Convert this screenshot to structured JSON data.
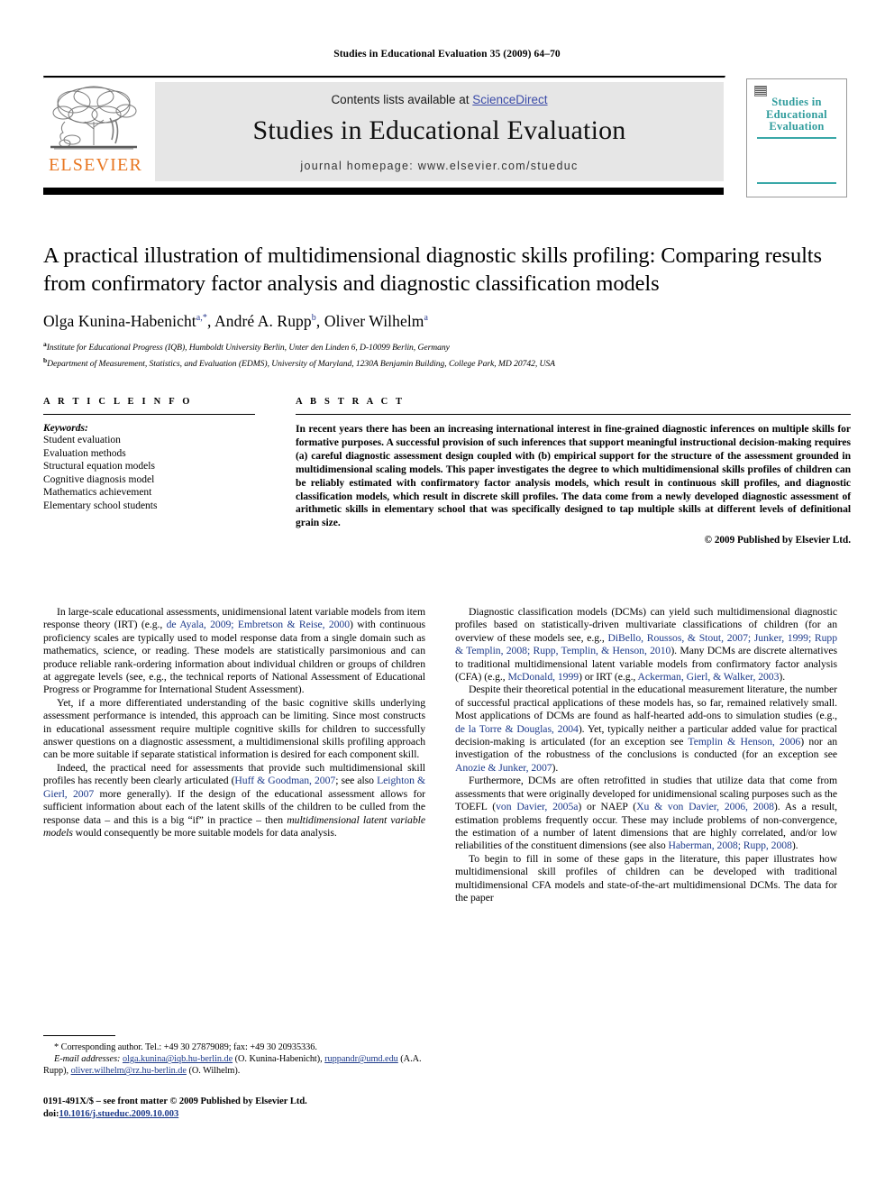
{
  "running_head": "Studies in Educational Evaluation 35 (2009) 64–70",
  "masthead": {
    "contents_prefix": "Contents lists available at ",
    "sciencedirect": "ScienceDirect",
    "journal_title": "Studies in Educational Evaluation",
    "homepage": "journal homepage: www.elsevier.com/stueduc",
    "publisher_logo_text": "ELSEVIER",
    "publisher_logo_color": "#E87722",
    "cover_title": "Studies in Educational Evaluation",
    "cover_accent_color": "#3aa8a8",
    "link_color": "#3b4ba8"
  },
  "article": {
    "title": "A practical illustration of multidimensional diagnostic skills profiling: Comparing results from confirmatory factor analysis and diagnostic classification models",
    "authors_html": "Olga Kunina-Habenicht<sup>a,*</sup>, André A. Rupp<sup>b</sup>, Oliver Wilhelm<sup>a</sup>",
    "affiliation_a": "Institute for Educational Progress (IQB), Humboldt University Berlin, Unter den Linden 6, D-10099 Berlin, Germany",
    "affiliation_b": "Department of Measurement, Statistics, and Evaluation (EDMS), University of Maryland, 1230A Benjamin Building, College Park, MD 20742, USA"
  },
  "article_info": {
    "heading": "A R T I C L E   I N F O",
    "keywords_label": "Keywords:",
    "keywords": [
      "Student evaluation",
      "Evaluation methods",
      "Structural equation models",
      "Cognitive diagnosis model",
      "Mathematics achievement",
      "Elementary school students"
    ]
  },
  "abstract": {
    "heading": "A B S T R A C T",
    "text": "In recent years there has been an increasing international interest in fine-grained diagnostic inferences on multiple skills for formative purposes. A successful provision of such inferences that support meaningful instructional decision-making requires (a) careful diagnostic assessment design coupled with (b) empirical support for the structure of the assessment grounded in multidimensional scaling models. This paper investigates the degree to which multidimensional skills profiles of children can be reliably estimated with confirmatory factor analysis models, which result in continuous skill profiles, and diagnostic classification models, which result in discrete skill profiles. The data come from a newly developed diagnostic assessment of arithmetic skills in elementary school that was specifically designed to tap multiple skills at different levels of definitional grain size.",
    "copyright": "© 2009 Published by Elsevier Ltd."
  },
  "body": {
    "left_paragraphs": [
      "In large-scale educational assessments, unidimensional latent variable models from item response theory (IRT) (e.g., |de Ayala, 2009; Embretson & Reise, 2000|) with continuous proficiency scales are typically used to model response data from a single domain such as mathematics, science, or reading. These models are statistically parsimonious and can produce reliable rank-ordering information about individual children or groups of children at aggregate levels (see, e.g., the technical reports of National Assessment of Educational Progress or Programme for International Student Assessment).",
      "Yet, if a more differentiated understanding of the basic cognitive skills underlying assessment performance is intended, this approach can be limiting. Since most constructs in educational assessment require multiple cognitive skills for children to successfully answer questions on a diagnostic assessment, a multidimensional skills profiling approach can be more suitable if separate statistical information is desired for each component skill.",
      "Indeed, the practical need for assessments that provide such multidimensional skill profiles has recently been clearly articulated (|Huff & Goodman, 2007|; see also |Leighton & Gierl, 2007| more generally). If the design of the educational assessment allows for sufficient information about each of the latent skills of the children to be culled from the response data – and this is a big “if” in practice – then #multidimensional latent variable models# would consequently be more suitable models for data analysis."
    ],
    "right_paragraphs": [
      "Diagnostic classification models (DCMs) can yield such multidimensional diagnostic profiles based on statistically-driven multivariate classifications of children (for an overview of these models see, e.g., |DiBello, Roussos, & Stout, 2007; Junker, 1999; Rupp & Templin, 2008; Rupp, Templin, & Henson, 2010|). Many DCMs are discrete alternatives to traditional multidimensional latent variable models from confirmatory factor analysis (CFA) (e.g., |McDonald, 1999|) or IRT (e.g., |Ackerman, Gierl, & Walker, 2003|).",
      "Despite their theoretical potential in the educational measurement literature, the number of successful practical applications of these models has, so far, remained relatively small. Most applications of DCMs are found as half-hearted add-ons to simulation studies (e.g., |de la Torre & Douglas, 2004|). Yet, typically neither a particular added value for practical decision-making is articulated (for an exception see |Templin & Henson, 2006|) nor an investigation of the robustness of the conclusions is conducted (for an exception see |Anozie & Junker, 2007|).",
      "Furthermore, DCMs are often retrofitted in studies that utilize data that come from assessments that were originally developed for unidimensional scaling purposes such as the TOEFL (|von Davier, 2005a|) or NAEP (|Xu & von Davier, 2006, 2008|). As a result, estimation problems frequently occur. These may include problems of non-convergence, the estimation of a number of latent dimensions that are highly correlated, and/or low reliabilities of the constituent dimensions (see also |Haberman, 2008; Rupp, 2008|).",
      "To begin to fill in some of these gaps in the literature, this paper illustrates how multidimensional skill profiles of children can be developed with traditional multidimensional CFA models and state-of-the-art multidimensional DCMs. The data for the paper"
    ]
  },
  "footnotes": {
    "corresponding": "* Corresponding author. Tel.: +49 30 27879089; fax: +49 30 20935336.",
    "email_label": "E-mail addresses:",
    "email_1": "olga.kunina@iqb.hu-berlin.de",
    "email_1_owner": " (O. Kunina-Habenicht),",
    "email_2": "ruppandr@umd.edu",
    "email_2_owner": " (A.A. Rupp),",
    "email_3": "oliver.wilhelm@rz.hu-berlin.de",
    "email_3_owner": " (O. Wilhelm).",
    "issn_line": "0191-491X/$ – see front matter © 2009 Published by Elsevier Ltd.",
    "doi_label": "doi:",
    "doi_value": "10.1016/j.stueduc.2009.10.003"
  }
}
